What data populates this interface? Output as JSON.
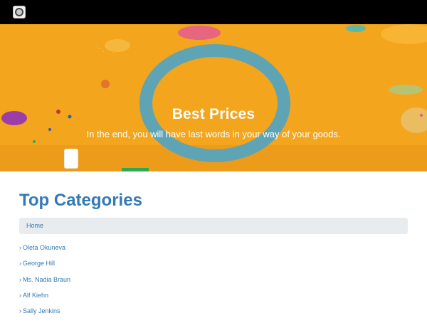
{
  "header": {
    "logo_icon": "badge-logo-icon"
  },
  "hero": {
    "title": "Best Prices",
    "subtitle": "In the end, you will have last words in your way of your goods.",
    "background_color": "#f2a51d",
    "ring_color": "#5fa4b5"
  },
  "main": {
    "section_title": "Top Categories",
    "breadcrumb": {
      "home_label": "Home"
    },
    "categories": [
      {
        "label": "Oleta Okuneva"
      },
      {
        "label": "George Hill"
      },
      {
        "label": "Ms. Nadia Braun"
      },
      {
        "label": "Alf Kiehn"
      },
      {
        "label": "Sally Jenkins"
      }
    ]
  },
  "colors": {
    "link": "#337ab7",
    "topbar": "#000000",
    "accent_bar": "#2fa84f"
  }
}
